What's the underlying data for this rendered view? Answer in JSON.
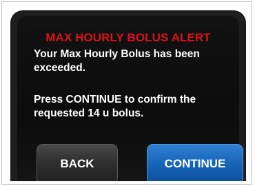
{
  "alert": {
    "title": "MAX HOURLY BOLUS ALERT",
    "message_line1": "Your Max Hourly Bolus has been exceeded.",
    "message_line2": "Press CONTINUE to confirm the requested 14 u bolus."
  },
  "buttons": {
    "back_label": "BACK",
    "continue_label": "CONTINUE"
  },
  "colors": {
    "title": "#e0111a",
    "continue_button": "#1765b8",
    "back_button": "#2f2f2f",
    "background": "#121212"
  }
}
